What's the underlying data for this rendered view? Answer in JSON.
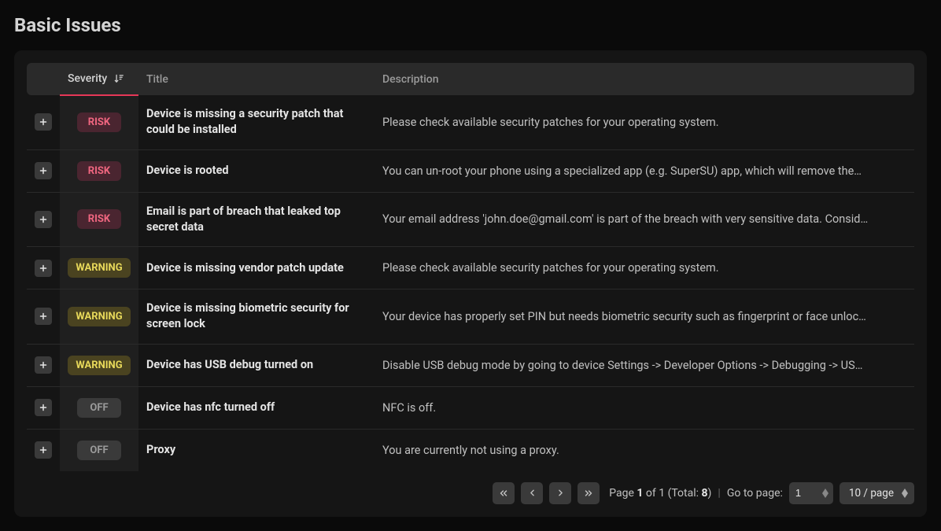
{
  "header": {
    "title": "Basic Issues"
  },
  "columns": {
    "expand": "",
    "severity": "Severity",
    "title": "Title",
    "description": "Description"
  },
  "badges": {
    "risk": "RISK",
    "warning": "WARNING",
    "off": "OFF"
  },
  "rows": [
    {
      "severity": "risk",
      "title": "Device is missing a security patch that could be installed",
      "description": "Please check available security patches for your operating system."
    },
    {
      "severity": "risk",
      "title": "Device is rooted",
      "description": "You can un-root your phone using a specialized app (e.g. SuperSU) app, which will remove the…"
    },
    {
      "severity": "risk",
      "title": "Email is part of breach that leaked top secret data",
      "description": "Your email address 'john.doe@gmail.com' is part of the breach with very sensitive data. Consid…"
    },
    {
      "severity": "warning",
      "title": "Device is missing vendor patch update",
      "description": "Please check available security patches for your operating system."
    },
    {
      "severity": "warning",
      "title": "Device is missing biometric security for screen lock",
      "description": "Your device has properly set PIN but needs biometric security such as fingerprint or face unloc…"
    },
    {
      "severity": "warning",
      "title": "Device has USB debug turned on",
      "description": "Disable USB debug mode by going to device Settings -> Developer Options -> Debugging -> US…"
    },
    {
      "severity": "off",
      "title": "Device has nfc turned off",
      "description": "NFC is off."
    },
    {
      "severity": "off",
      "title": "Proxy",
      "description": "You are currently not using a proxy."
    }
  ],
  "pagination": {
    "page_label": "Page",
    "current_page": "1",
    "of_label": "of 1 (Total:",
    "total": "8",
    "close_paren": ")",
    "goto_label": "Go to page:",
    "goto_value": "1",
    "page_size_label": "10 / page"
  }
}
